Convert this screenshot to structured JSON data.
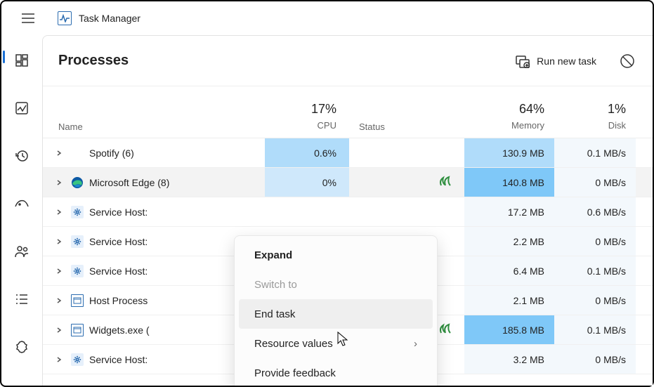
{
  "app": {
    "title": "Task Manager"
  },
  "nav": {
    "items": [
      "processes",
      "performance",
      "history",
      "startup",
      "users",
      "details",
      "services"
    ]
  },
  "header": {
    "title": "Processes",
    "run_task": "Run new task"
  },
  "columns": {
    "name": "Name",
    "cpu_pct": "17%",
    "cpu_label": "CPU",
    "status": "Status",
    "mem_pct": "64%",
    "mem_label": "Memory",
    "disk_pct": "1%",
    "disk_label": "Disk"
  },
  "rows": [
    {
      "name": "Spotify (6)",
      "icon": "none",
      "cpu": "0.6%",
      "cpu_heat": "heat2",
      "status": "",
      "mem": "130.9 MB",
      "mem_heat": "heat2",
      "disk": "0.1 MB/s",
      "disk_heat": "heat0"
    },
    {
      "name": "Microsoft Edge (8)",
      "icon": "edge",
      "cpu": "0%",
      "cpu_heat": "heat1",
      "status": "leaf",
      "mem": "140.8 MB",
      "mem_heat": "heat3",
      "disk": "0 MB/s",
      "disk_heat": "heat0",
      "hover": true
    },
    {
      "name": "Service Host:",
      "icon": "gear",
      "cpu": "",
      "cpu_heat": "",
      "status": "",
      "mem": "17.2 MB",
      "mem_heat": "heat0",
      "disk": "0.6 MB/s",
      "disk_heat": "heat0"
    },
    {
      "name": "Service Host:",
      "icon": "gear",
      "cpu": "",
      "cpu_heat": "",
      "status": "",
      "mem": "2.2 MB",
      "mem_heat": "heat0",
      "disk": "0 MB/s",
      "disk_heat": "heat0"
    },
    {
      "name": "Service Host:",
      "icon": "gear",
      "cpu": "",
      "cpu_heat": "",
      "status": "",
      "mem": "6.4 MB",
      "mem_heat": "heat0",
      "disk": "0.1 MB/s",
      "disk_heat": "heat0"
    },
    {
      "name": "Host Process",
      "icon": "win",
      "cpu": "",
      "cpu_heat": "",
      "status": "",
      "mem": "2.1 MB",
      "mem_heat": "heat0",
      "disk": "0 MB/s",
      "disk_heat": "heat0"
    },
    {
      "name": "Widgets.exe (",
      "icon": "win",
      "cpu": "",
      "cpu_heat": "",
      "status": "leaf",
      "mem": "185.8 MB",
      "mem_heat": "heat3",
      "disk": "0.1 MB/s",
      "disk_heat": "heat0"
    },
    {
      "name": "Service Host:",
      "icon": "gear",
      "cpu": "",
      "cpu_heat": "",
      "status": "",
      "mem": "3.2 MB",
      "mem_heat": "heat0",
      "disk": "0 MB/s",
      "disk_heat": "heat0"
    }
  ],
  "context_menu": {
    "expand": "Expand",
    "switch_to": "Switch to",
    "end_task": "End task",
    "resource_values": "Resource values",
    "provide_feedback": "Provide feedback"
  }
}
